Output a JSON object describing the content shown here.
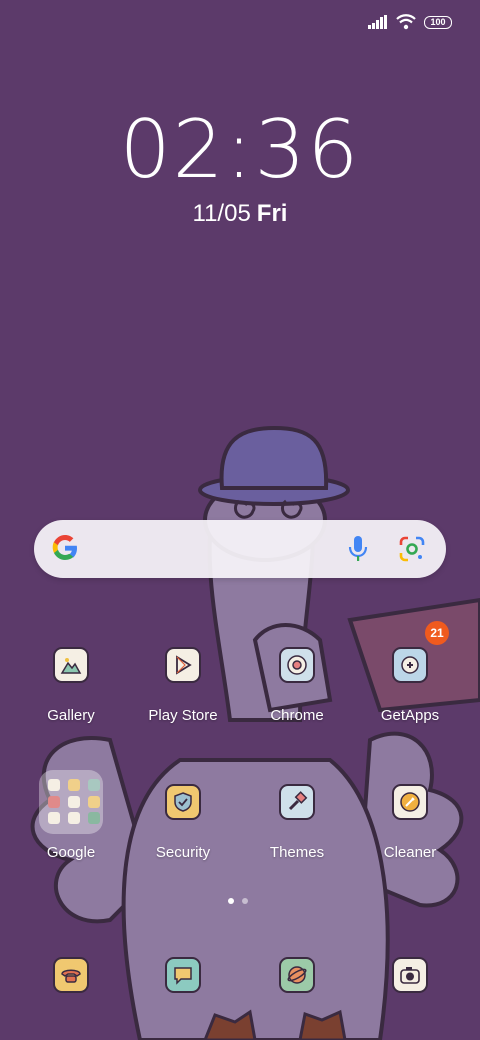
{
  "status_bar": {
    "battery": "100"
  },
  "lockclock": {
    "time": "02:36",
    "date": "11/05",
    "day": "Fri"
  },
  "apps_row1": [
    {
      "label": "Gallery"
    },
    {
      "label": "Play Store"
    },
    {
      "label": "Chrome"
    },
    {
      "label": "GetApps",
      "badge": "21"
    }
  ],
  "apps_row2": [
    {
      "label": "Google"
    },
    {
      "label": "Security"
    },
    {
      "label": "Themes"
    },
    {
      "label": "Cleaner"
    }
  ],
  "pager": {
    "pages": 2,
    "current": 1
  },
  "colors": {
    "wallpaper": "#5c3a6a",
    "badge": "#f05a1e"
  }
}
